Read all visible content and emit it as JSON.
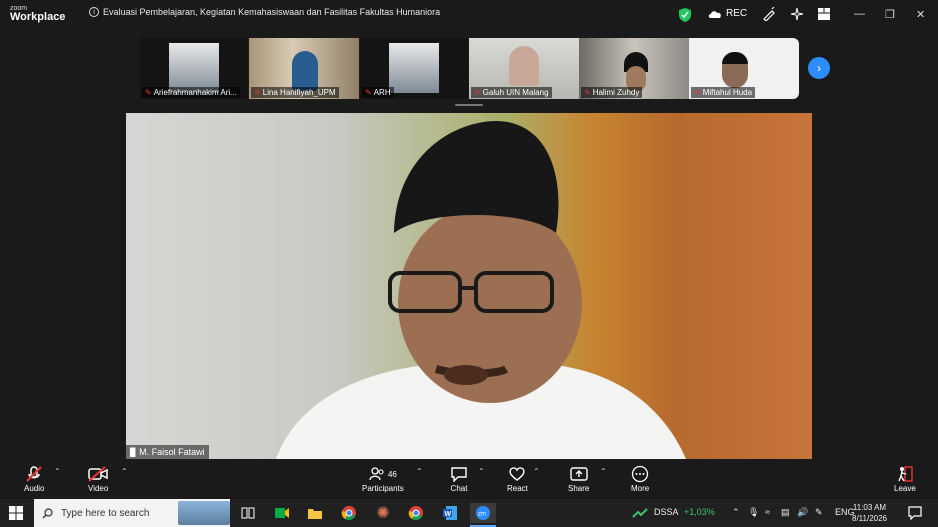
{
  "app": {
    "logo_top": "zoom",
    "logo_bottom": "Workplace"
  },
  "meeting": {
    "title": "Evaluasi Pembelajaran, Kegiatan Kemahasiswaan dan Fasilitas Fakultas Humaniora"
  },
  "titlebar": {
    "rec_label": "REC"
  },
  "participants_strip": [
    {
      "name": "Ariefrahmanhakim Ari..."
    },
    {
      "name": "Lina Hanifiyah_UPM"
    },
    {
      "name": "ARH"
    },
    {
      "name": "Galuh UIN Malang"
    },
    {
      "name": "Halimi Zuhdy"
    },
    {
      "name": "Miftahul Huda"
    }
  ],
  "main_speaker": {
    "name": "M. Faisol Fatawi"
  },
  "toolbar": {
    "audio": "Audio",
    "video": "Video",
    "participants": "Participants",
    "participants_count": "46",
    "chat": "Chat",
    "react": "React",
    "share": "Share",
    "more": "More",
    "leave": "Leave"
  },
  "taskbar": {
    "search_placeholder": "Type here to search",
    "stock_name": "DSSA",
    "stock_change": "+1,03%",
    "language": "ENG",
    "time": "11:03 AM",
    "date": "8/11/2026"
  },
  "colors": {
    "accent": "#2d8cff",
    "stock_up": "#3ec46d",
    "mic_off": "#e33333"
  }
}
